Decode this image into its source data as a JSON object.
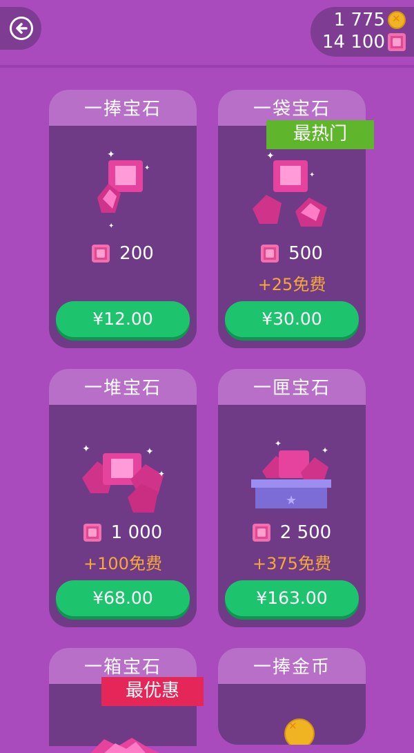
{
  "wallet": {
    "coins": "1 775",
    "gems": "14 100"
  },
  "cards": [
    {
      "title": "一捧宝石",
      "amount": "200",
      "bonus": "",
      "price": "¥12.00"
    },
    {
      "title": "一袋宝石",
      "amount": "500",
      "bonus": "+25免费",
      "price": "¥30.00",
      "ribbon": "最热门"
    },
    {
      "title": "一堆宝石",
      "amount": "1 000",
      "bonus": "+100免费",
      "price": "¥68.00"
    },
    {
      "title": "一匣宝石",
      "amount": "2 500",
      "bonus": "+375免费",
      "price": "¥163.00"
    },
    {
      "title": "一箱宝石",
      "ribbon": "最优惠"
    },
    {
      "title": "一捧金币"
    }
  ],
  "colors": {
    "background": "#a94bbd",
    "card": "#6f3b86",
    "card_header": "#b86fc8",
    "buy_button": "#1ec46d",
    "bonus_text": "#f4a93a",
    "hot_ribbon": "#5fb52c",
    "best_ribbon": "#e52658"
  }
}
